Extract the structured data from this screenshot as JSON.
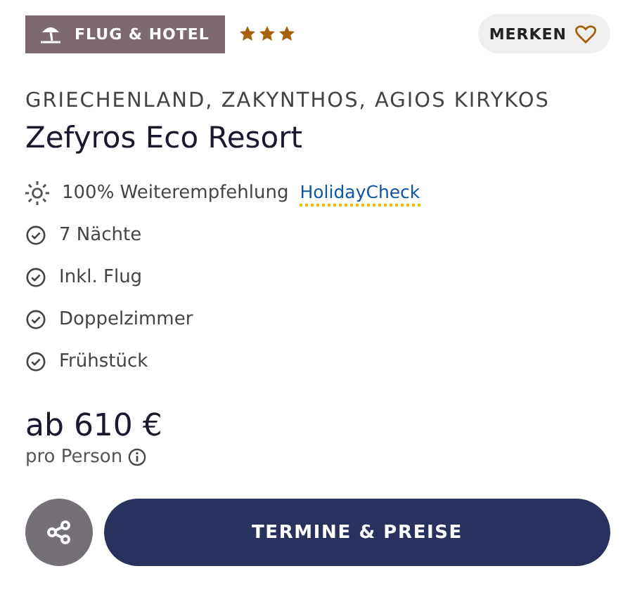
{
  "badge": {
    "label": "FLUG & HOTEL"
  },
  "stars": 3,
  "bookmark": {
    "label": "MERKEN",
    "saved": false
  },
  "location": "GRIECHENLAND, ZAKYNTHOS, AGIOS KIRYKOS",
  "title": "Zefyros Eco Resort",
  "features": [
    {
      "kind": "recommendation",
      "text": "100% Weiterempfehlung",
      "source": "HolidayCheck"
    },
    {
      "kind": "included",
      "text": "7 Nächte"
    },
    {
      "kind": "included",
      "text": "Inkl. Flug"
    },
    {
      "kind": "included",
      "text": "Doppelzimmer"
    },
    {
      "kind": "included",
      "text": "Frühstück"
    }
  ],
  "price": {
    "amount": "ab 610 €",
    "unit": "pro Person"
  },
  "actions": {
    "cta": "TERMINE & PREISE"
  }
}
